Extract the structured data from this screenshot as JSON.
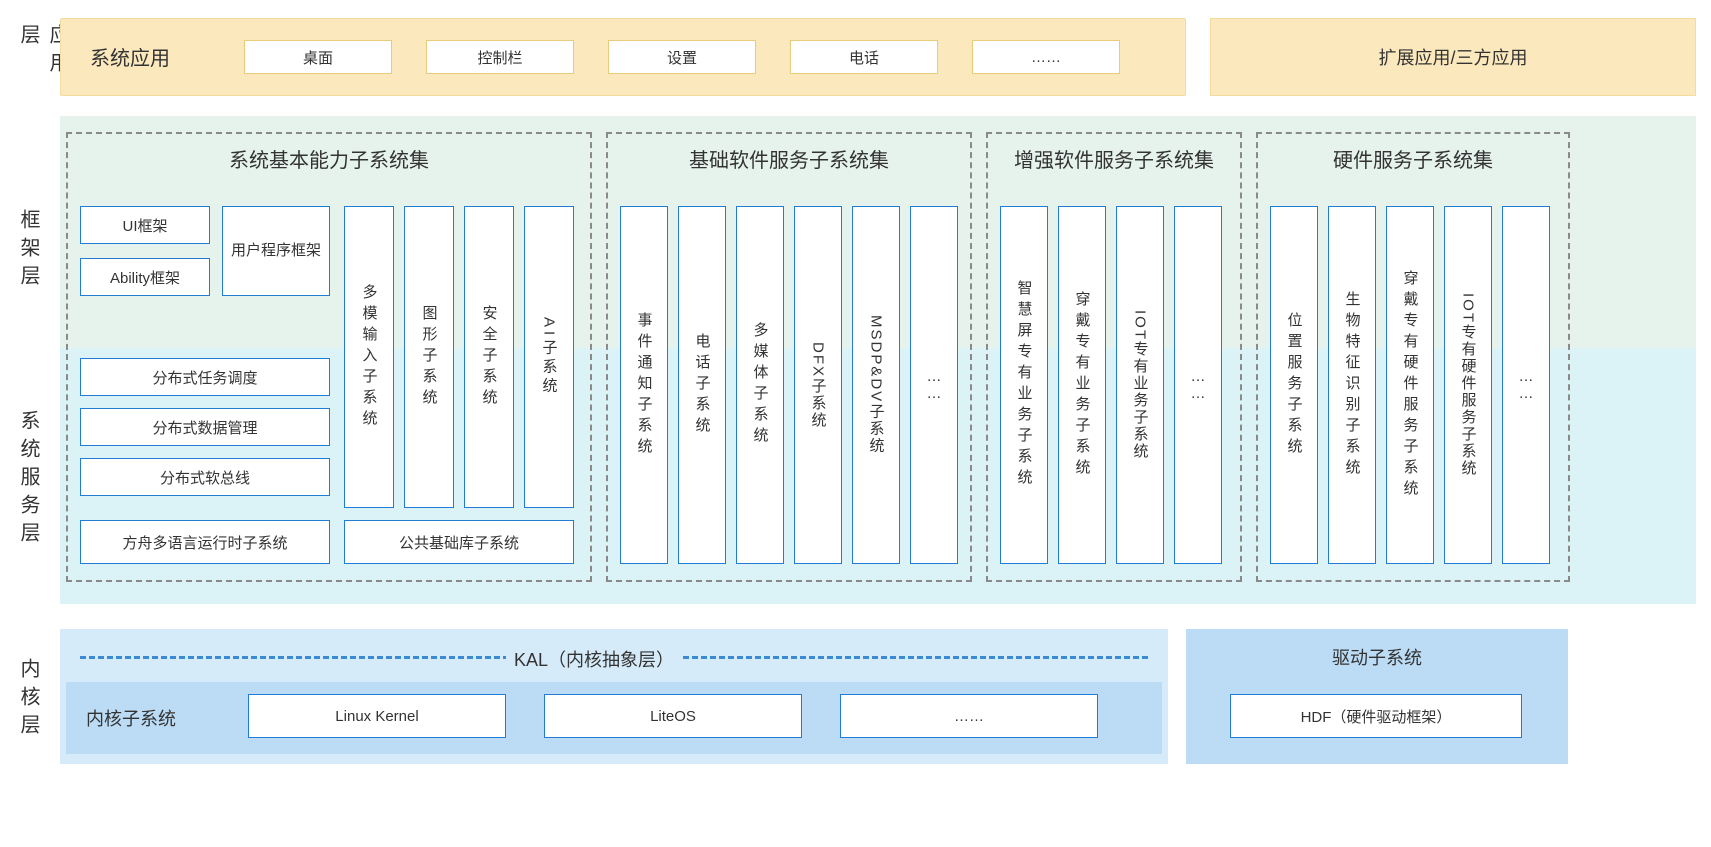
{
  "layers": {
    "app": "应用层",
    "framework": "框架层",
    "service": "系统服务层",
    "kernel": "内核层"
  },
  "app_layer": {
    "system_apps_label": "系统应用",
    "apps": [
      "桌面",
      "控制栏",
      "设置",
      "电话",
      "……"
    ],
    "extended": "扩展应用/三方应用"
  },
  "groups": {
    "basic": {
      "title": "系统基本能力子系统集",
      "ui_fw": "UI框架",
      "ability_fw": "Ability框架",
      "user_prog_fw": "用户程序框架",
      "vcols": [
        "多模输入子系统",
        "图形子系统",
        "安全子系统",
        "AI子系统"
      ],
      "dist_task": "分布式任务调度",
      "dist_data": "分布式数据管理",
      "dist_bus": "分布式软总线",
      "ark": "方舟多语言运行时子系统",
      "pubbase": "公共基础库子系统"
    },
    "swservice": {
      "title": "基础软件服务子系统集",
      "cols": [
        "事件通知子系统",
        "电话子系统",
        "多媒体子系统",
        "DFX子系统",
        "MSDP&DV子系统",
        "……"
      ]
    },
    "enhanced": {
      "title": "增强软件服务子系统集",
      "cols": [
        "智慧屏专有业务子系统",
        "穿戴专有业务子系统",
        "IOT专有业务子系统",
        "……"
      ]
    },
    "hw": {
      "title": "硬件服务子系统集",
      "cols": [
        "位置服务子系统",
        "生物特征识别子系统",
        "穿戴专有硬件服务子系统",
        "IOT专有硬件服务子系统",
        "……"
      ]
    }
  },
  "kernel": {
    "kal": "KAL（内核抽象层）",
    "kernel_sub": "内核子系统",
    "kernels": [
      "Linux Kernel",
      "LiteOS",
      "……"
    ],
    "driver_sub": "驱动子系统",
    "hdf": "HDF（硬件驱动框架）"
  }
}
